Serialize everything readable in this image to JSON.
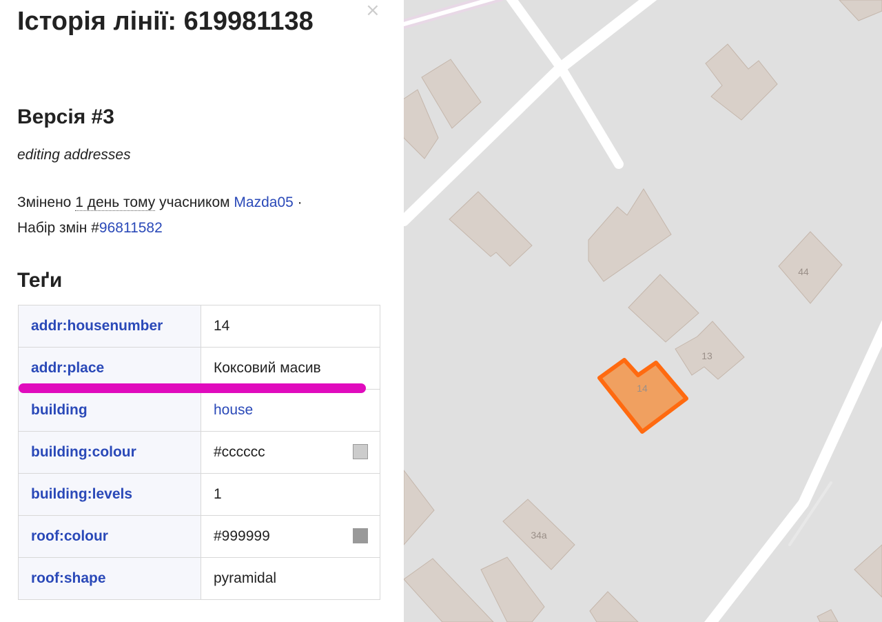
{
  "sidebar": {
    "title": "Історія лінії: 619981138",
    "close_symbol": "×",
    "version_heading": "Версія #3",
    "comment": "editing addresses",
    "meta": {
      "changed_prefix": "Змінено ",
      "time_ago": "1 день тому",
      "by_text": " учасником ",
      "user": "Mazda05",
      "separator": " ·",
      "changeset_prefix": "Набір змін #",
      "changeset_id": "96811582"
    },
    "tags_heading": "Теґи",
    "tags": [
      {
        "key": "addr:housenumber",
        "value": "14"
      },
      {
        "key": "addr:place",
        "value": "Коксовий масив"
      },
      {
        "key": "building",
        "value": "house"
      },
      {
        "key": "building:colour",
        "value": "#cccccc",
        "swatch": "#cccccc"
      },
      {
        "key": "building:levels",
        "value": "1"
      },
      {
        "key": "roof:colour",
        "value": "#999999",
        "swatch": "#999999"
      },
      {
        "key": "roof:shape",
        "value": "pyramidal"
      }
    ],
    "highlight_color": "#e00bbd"
  },
  "map": {
    "background": "#e0e0e0",
    "building_fill": "#d9d0c9",
    "building_stroke": "#c4b6ab",
    "selected_fill": "#f0a060",
    "selected_stroke": "#ff6a10",
    "labels": {
      "selected": "14",
      "b44": "44",
      "b13": "13",
      "b34a": "34a"
    }
  }
}
